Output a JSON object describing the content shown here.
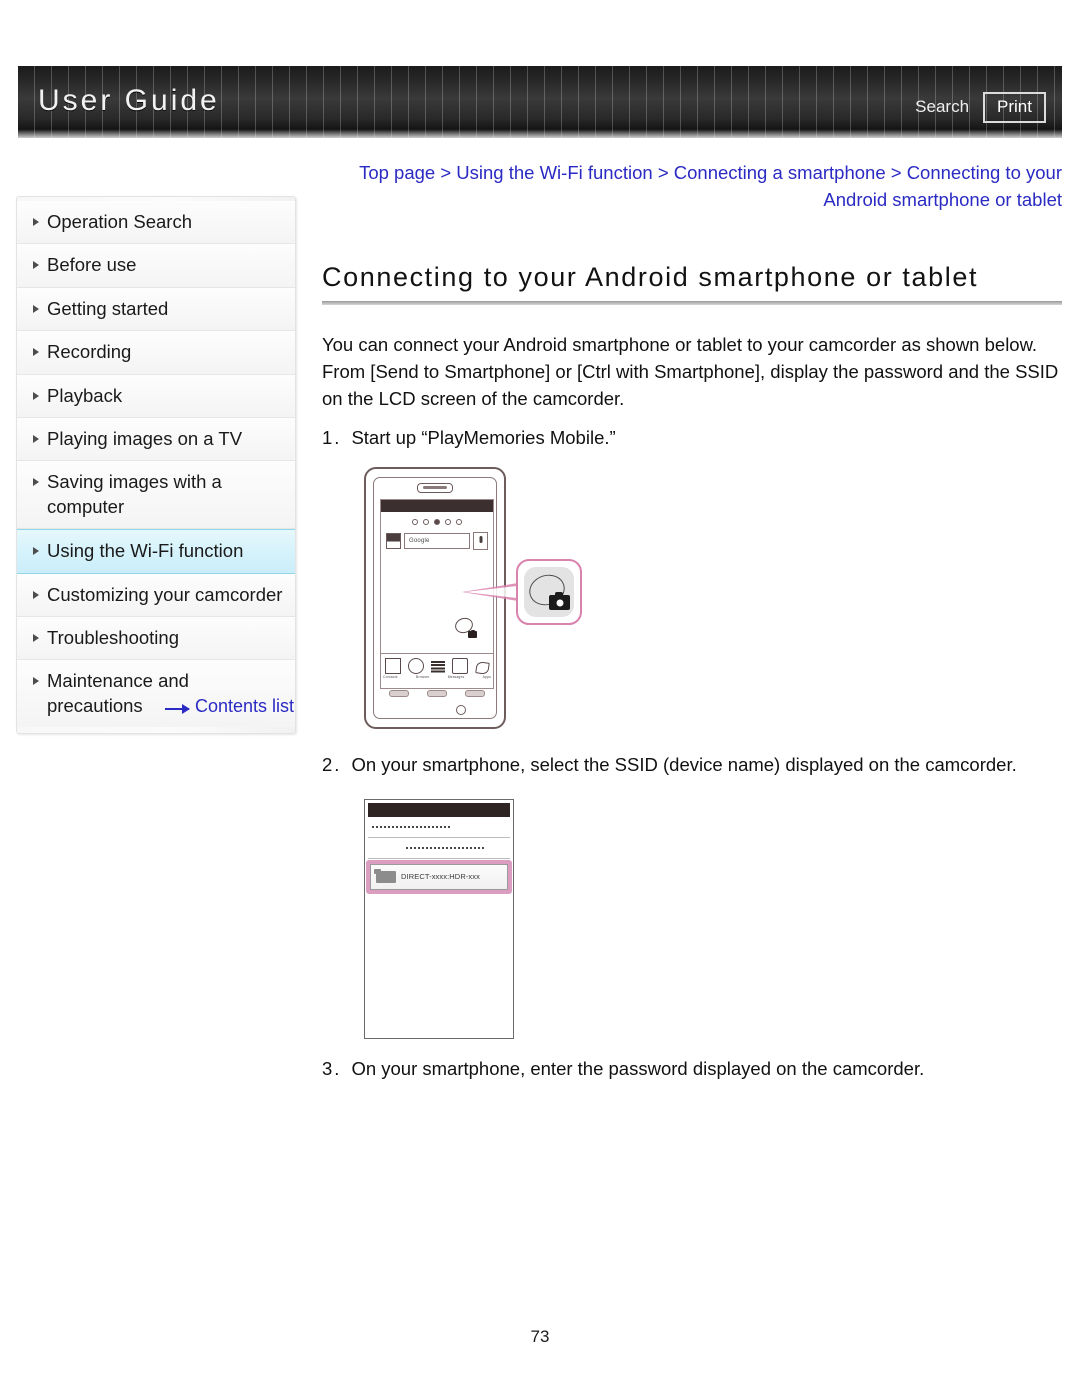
{
  "header": {
    "title": "User Guide",
    "search_label": "Search",
    "print_label": "Print"
  },
  "sidebar": {
    "items": [
      {
        "label": "Operation Search",
        "active": false
      },
      {
        "label": "Before use",
        "active": false
      },
      {
        "label": "Getting started",
        "active": false
      },
      {
        "label": "Recording",
        "active": false
      },
      {
        "label": "Playback",
        "active": false
      },
      {
        "label": "Playing images on a TV",
        "active": false
      },
      {
        "label": "Saving images with a computer",
        "active": false
      },
      {
        "label": "Using the Wi-Fi function",
        "active": true
      },
      {
        "label": "Customizing your camcorder",
        "active": false
      },
      {
        "label": "Troubleshooting",
        "active": false
      },
      {
        "label": "Maintenance and precautions",
        "active": false
      }
    ],
    "contents_list_label": "Contents list"
  },
  "main": {
    "breadcrumb": "Top page > Using the Wi-Fi function > Connecting a smartphone > Connecting to your Android smartphone or tablet",
    "title": "Connecting to your Android smartphone or tablet",
    "intro": "You can connect your Android smartphone or tablet to your camcorder as shown below. From [Send to Smartphone] or [Ctrl with Smartphone], display the password and the SSID on the LCD screen of the camcorder.",
    "steps": [
      {
        "num": "1.",
        "text": "Start up “PlayMemories Mobile.”"
      },
      {
        "num": "2.",
        "text": "On your smartphone, select the SSID (device name) displayed on the camcorder."
      },
      {
        "num": "3.",
        "text": "On your smartphone, enter the password displayed on the camcorder."
      }
    ]
  },
  "figure_phone": {
    "search_placeholder": "Google",
    "dock_labels": [
      "Contacts",
      "Browser",
      "",
      "Messages",
      "Apps"
    ],
    "callout_icon": "playmemories-mobile-app-icon"
  },
  "figure_ssid": {
    "ssid_value": "DIRECT-xxxx:HDR-xxx"
  },
  "footer": {
    "page_number": "73"
  },
  "colors": {
    "link": "#2a2ac4",
    "active_nav": "#cbeef9",
    "highlight_pink": "#d982ad",
    "header_dark": "#262626"
  }
}
